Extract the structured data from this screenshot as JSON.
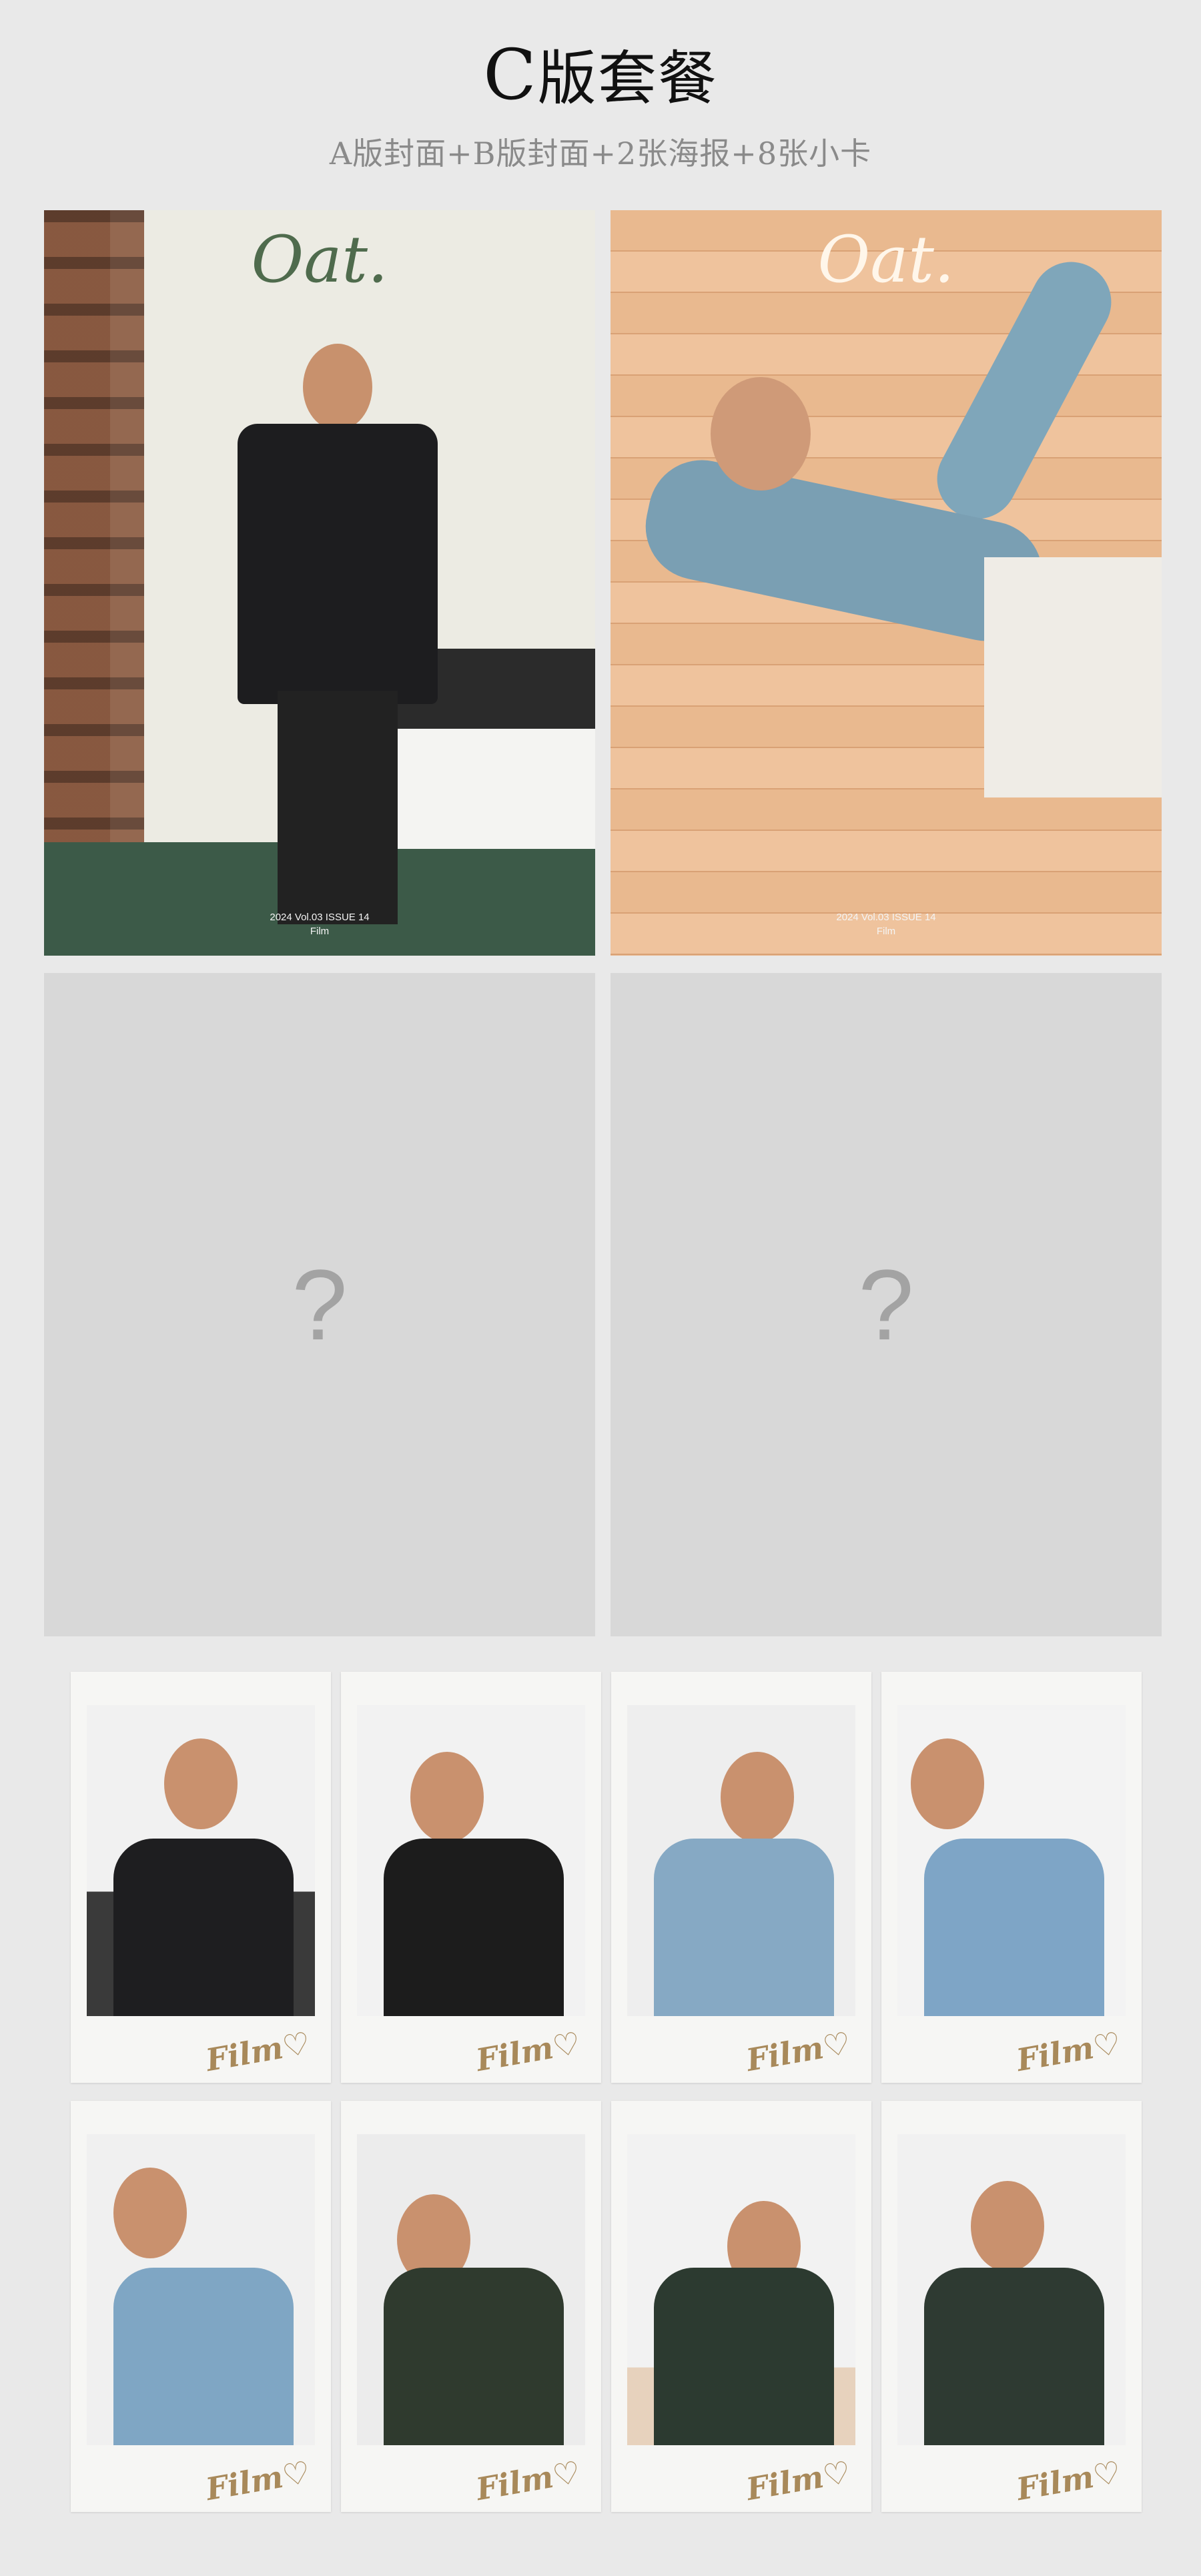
{
  "header": {
    "title_letter": "C",
    "title_rest": "版套餐",
    "subtitle": "A版封面+B版封面+2张海报+8张小卡"
  },
  "covers": [
    {
      "logo": "Oat.",
      "issue_line": "2024 Vol.03  ISSUE 14",
      "name": "Film"
    },
    {
      "logo": "Oat.",
      "issue_line": "2024 Vol.03  ISSUE 14",
      "name": "Film"
    }
  ],
  "posters": [
    {
      "placeholder": "?"
    },
    {
      "placeholder": "?"
    }
  ],
  "cards": [
    {
      "signature": "Film♡",
      "outfit": "black suit"
    },
    {
      "signature": "Film♡",
      "outfit": "black knit"
    },
    {
      "signature": "Film♡",
      "outfit": "blue denim jacket"
    },
    {
      "signature": "Film♡",
      "outfit": "blue denim jacket"
    },
    {
      "signature": "Film♡",
      "outfit": "blue denim jacket"
    },
    {
      "signature": "Film♡",
      "outfit": "dark green Dior knit"
    },
    {
      "signature": "Film♡",
      "outfit": "dark green knit"
    },
    {
      "signature": "Film♡",
      "outfit": "dark green Dior knit"
    }
  ],
  "colors": {
    "background": "#e9e9e9",
    "placeholder": "#d8d8d8",
    "signature_gold": "#a8895a"
  }
}
